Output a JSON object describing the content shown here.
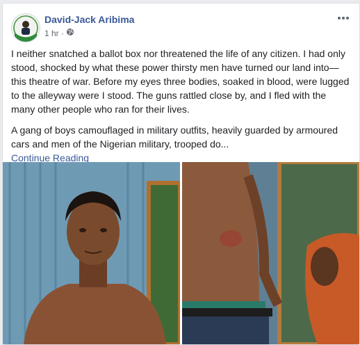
{
  "post": {
    "author": "David-Jack Aribima",
    "time": "1 hr",
    "separator": "·",
    "audience_icon": "globe-icon",
    "paragraphs": [
      "I neither snatched a ballot box nor threatened the life of any citizen. I had only stood, shocked by what these power thirsty men have turned our land into—this theatre of war. Before my eyes three bodies, soaked in blood, were lugged to the alleyway were I stood. The guns rattled close by, and I fled with the many other people who ran for their lives.",
      "A gang of boys camouflaged in military outfits, heavily guarded by armoured cars and men of the Nigerian military, trooped do..."
    ],
    "continue_label": "Continue Reading",
    "photos": [
      "photo-man-portrait",
      "photo-torso-injury"
    ],
    "options_icon": "more-options-icon"
  },
  "colors": {
    "link": "#385898",
    "text": "#1c1e21",
    "meta": "#616770",
    "background": "#e9ebee"
  }
}
